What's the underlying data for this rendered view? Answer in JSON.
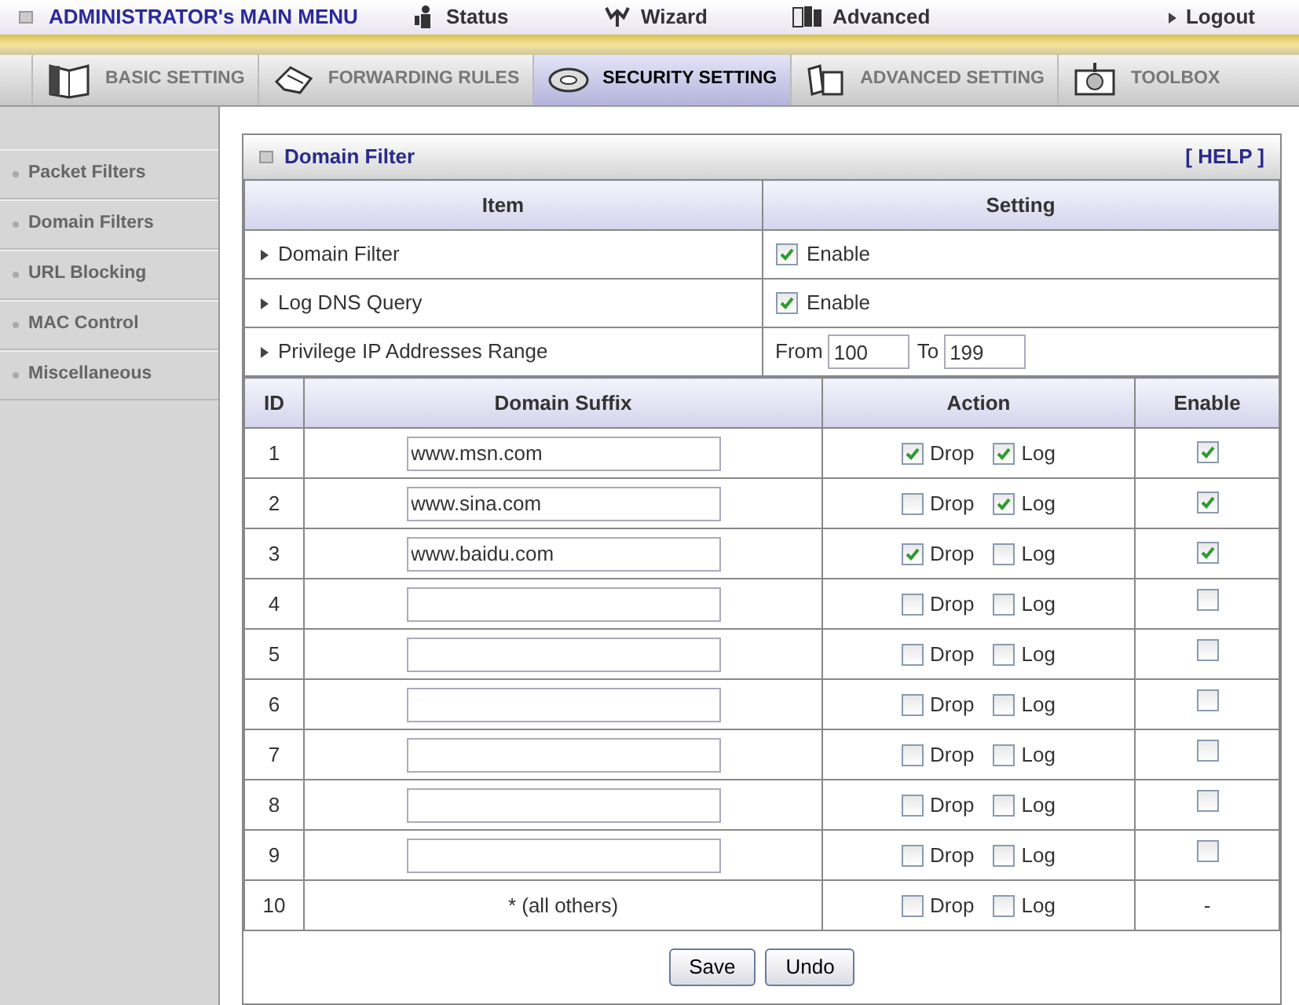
{
  "top_menu": {
    "title": "ADMINISTRATOR's MAIN MENU",
    "items": [
      {
        "label": "Status"
      },
      {
        "label": "Wizard"
      },
      {
        "label": "Advanced"
      }
    ],
    "logout": "Logout"
  },
  "tabs": [
    {
      "label": "BASIC SETTING",
      "selected": false
    },
    {
      "label": "FORWARDING RULES",
      "selected": false
    },
    {
      "label": "SECURITY SETTING",
      "selected": true
    },
    {
      "label": "ADVANCED SETTING",
      "selected": false
    },
    {
      "label": "TOOLBOX",
      "selected": false
    }
  ],
  "sidebar": {
    "items": [
      {
        "label": "Packet Filters"
      },
      {
        "label": "Domain Filters"
      },
      {
        "label": "URL Blocking"
      },
      {
        "label": "MAC Control"
      },
      {
        "label": "Miscellaneous"
      }
    ]
  },
  "panel": {
    "title": "Domain Filter",
    "help": "[ HELP ]",
    "settings_columns": [
      "Item",
      "Setting"
    ],
    "settings": [
      {
        "kind": "checkbox",
        "label": "Domain Filter",
        "option": "Enable",
        "checked": true
      },
      {
        "kind": "checkbox",
        "label": "Log DNS Query",
        "option": "Enable",
        "checked": true
      },
      {
        "kind": "range",
        "label": "Privilege IP Addresses Range",
        "from_label": "From",
        "from": "100",
        "to_label": "To",
        "to": "199"
      }
    ],
    "columns": [
      "ID",
      "Domain Suffix",
      "Action",
      "Enable"
    ],
    "rows": [
      {
        "kind": "input",
        "id": "1",
        "suffix": "www.msn.com",
        "drop_label": "Drop",
        "drop": true,
        "log_label": "Log",
        "log": true,
        "enable": true
      },
      {
        "kind": "input",
        "id": "2",
        "suffix": "www.sina.com",
        "drop_label": "Drop",
        "drop": false,
        "log_label": "Log",
        "log": true,
        "enable": true
      },
      {
        "kind": "input",
        "id": "3",
        "suffix": "www.baidu.com",
        "drop_label": "Drop",
        "drop": true,
        "log_label": "Log",
        "log": false,
        "enable": true
      },
      {
        "kind": "input",
        "id": "4",
        "drop_label": "Drop",
        "drop": false,
        "log_label": "Log",
        "log": false,
        "enable": false
      },
      {
        "kind": "input",
        "id": "5",
        "drop_label": "Drop",
        "drop": false,
        "log_label": "Log",
        "log": false,
        "enable": false
      },
      {
        "kind": "input",
        "id": "6",
        "drop_label": "Drop",
        "drop": false,
        "log_label": "Log",
        "log": false,
        "enable": false
      },
      {
        "kind": "input",
        "id": "7",
        "drop_label": "Drop",
        "drop": false,
        "log_label": "Log",
        "log": false,
        "enable": false
      },
      {
        "kind": "input",
        "id": "8",
        "drop_label": "Drop",
        "drop": false,
        "log_label": "Log",
        "log": false,
        "enable": false
      },
      {
        "kind": "input",
        "id": "9",
        "drop_label": "Drop",
        "drop": false,
        "log_label": "Log",
        "log": false,
        "enable": false
      },
      {
        "kind": "fixed",
        "id": "10",
        "suffix": "* (all others)",
        "drop_label": "Drop",
        "drop": false,
        "log_label": "Log",
        "log": false,
        "enable_text": "-"
      }
    ],
    "buttons": [
      "Save",
      "Undo"
    ]
  }
}
